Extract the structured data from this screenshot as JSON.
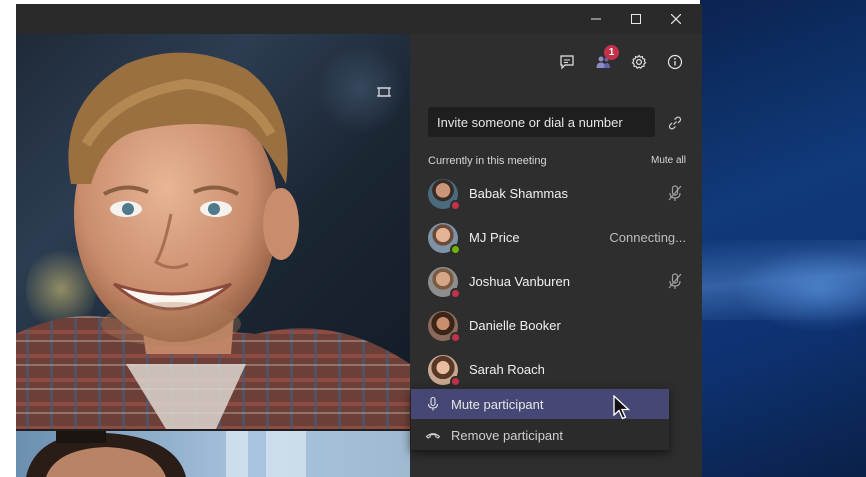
{
  "window": {
    "controls": {
      "minimize_icon": "minimize-icon",
      "maximize_icon": "maximize-icon",
      "close_icon": "close-icon"
    }
  },
  "header": {
    "icons": [
      "chat-icon",
      "participants-icon",
      "settings-icon",
      "info-icon"
    ],
    "participants_badge": "1"
  },
  "invite": {
    "placeholder": "Invite someone or dial a number",
    "link_icon": "link-icon"
  },
  "meeting": {
    "section_label": "Currently in this meeting",
    "mute_all_label": "Mute all",
    "participants": [
      {
        "name": "Babak Shammas",
        "status": "",
        "muted": true,
        "presence": "busy"
      },
      {
        "name": "MJ Price",
        "status": "Connecting...",
        "muted": false,
        "presence": "available"
      },
      {
        "name": "Joshua Vanburen",
        "status": "",
        "muted": true,
        "presence": "busy"
      },
      {
        "name": "Danielle Booker",
        "status": "",
        "muted": false,
        "presence": "busy"
      },
      {
        "name": "Sarah Roach",
        "status": "",
        "muted": false,
        "presence": "busy"
      }
    ]
  },
  "context_menu": {
    "items": [
      {
        "label": "Mute participant",
        "icon": "microphone-icon"
      },
      {
        "label": "Remove participant",
        "icon": "hang-up-icon"
      }
    ]
  },
  "colors": {
    "panel_bg": "#2f2e2e",
    "menu_highlight": "#464775",
    "badge": "#c4314b",
    "presence_busy": "#c4314b",
    "presence_available": "#6bb700"
  }
}
